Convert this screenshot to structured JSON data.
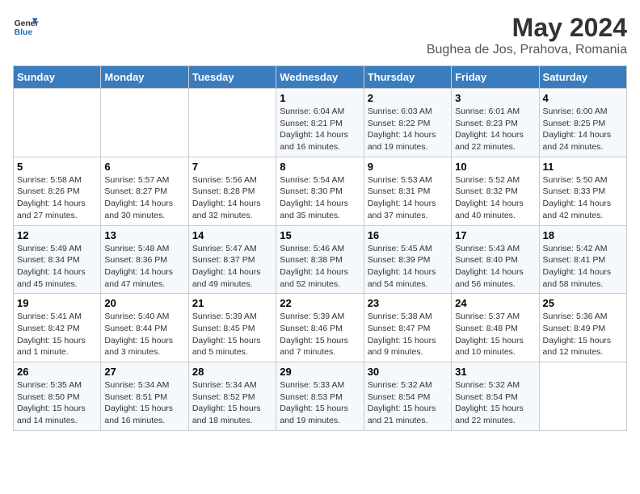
{
  "header": {
    "logo_line1": "General",
    "logo_line2": "Blue",
    "month_title": "May 2024",
    "location": "Bughea de Jos, Prahova, Romania"
  },
  "weekdays": [
    "Sunday",
    "Monday",
    "Tuesday",
    "Wednesday",
    "Thursday",
    "Friday",
    "Saturday"
  ],
  "weeks": [
    [
      null,
      null,
      null,
      {
        "day": 1,
        "sunrise": "6:04 AM",
        "sunset": "8:21 PM",
        "daylight": "14 hours and 16 minutes."
      },
      {
        "day": 2,
        "sunrise": "6:03 AM",
        "sunset": "8:22 PM",
        "daylight": "14 hours and 19 minutes."
      },
      {
        "day": 3,
        "sunrise": "6:01 AM",
        "sunset": "8:23 PM",
        "daylight": "14 hours and 22 minutes."
      },
      {
        "day": 4,
        "sunrise": "6:00 AM",
        "sunset": "8:25 PM",
        "daylight": "14 hours and 24 minutes."
      }
    ],
    [
      {
        "day": 5,
        "sunrise": "5:58 AM",
        "sunset": "8:26 PM",
        "daylight": "14 hours and 27 minutes."
      },
      {
        "day": 6,
        "sunrise": "5:57 AM",
        "sunset": "8:27 PM",
        "daylight": "14 hours and 30 minutes."
      },
      {
        "day": 7,
        "sunrise": "5:56 AM",
        "sunset": "8:28 PM",
        "daylight": "14 hours and 32 minutes."
      },
      {
        "day": 8,
        "sunrise": "5:54 AM",
        "sunset": "8:30 PM",
        "daylight": "14 hours and 35 minutes."
      },
      {
        "day": 9,
        "sunrise": "5:53 AM",
        "sunset": "8:31 PM",
        "daylight": "14 hours and 37 minutes."
      },
      {
        "day": 10,
        "sunrise": "5:52 AM",
        "sunset": "8:32 PM",
        "daylight": "14 hours and 40 minutes."
      },
      {
        "day": 11,
        "sunrise": "5:50 AM",
        "sunset": "8:33 PM",
        "daylight": "14 hours and 42 minutes."
      }
    ],
    [
      {
        "day": 12,
        "sunrise": "5:49 AM",
        "sunset": "8:34 PM",
        "daylight": "14 hours and 45 minutes."
      },
      {
        "day": 13,
        "sunrise": "5:48 AM",
        "sunset": "8:36 PM",
        "daylight": "14 hours and 47 minutes."
      },
      {
        "day": 14,
        "sunrise": "5:47 AM",
        "sunset": "8:37 PM",
        "daylight": "14 hours and 49 minutes."
      },
      {
        "day": 15,
        "sunrise": "5:46 AM",
        "sunset": "8:38 PM",
        "daylight": "14 hours and 52 minutes."
      },
      {
        "day": 16,
        "sunrise": "5:45 AM",
        "sunset": "8:39 PM",
        "daylight": "14 hours and 54 minutes."
      },
      {
        "day": 17,
        "sunrise": "5:43 AM",
        "sunset": "8:40 PM",
        "daylight": "14 hours and 56 minutes."
      },
      {
        "day": 18,
        "sunrise": "5:42 AM",
        "sunset": "8:41 PM",
        "daylight": "14 hours and 58 minutes."
      }
    ],
    [
      {
        "day": 19,
        "sunrise": "5:41 AM",
        "sunset": "8:42 PM",
        "daylight": "15 hours and 1 minute."
      },
      {
        "day": 20,
        "sunrise": "5:40 AM",
        "sunset": "8:44 PM",
        "daylight": "15 hours and 3 minutes."
      },
      {
        "day": 21,
        "sunrise": "5:39 AM",
        "sunset": "8:45 PM",
        "daylight": "15 hours and 5 minutes."
      },
      {
        "day": 22,
        "sunrise": "5:39 AM",
        "sunset": "8:46 PM",
        "daylight": "15 hours and 7 minutes."
      },
      {
        "day": 23,
        "sunrise": "5:38 AM",
        "sunset": "8:47 PM",
        "daylight": "15 hours and 9 minutes."
      },
      {
        "day": 24,
        "sunrise": "5:37 AM",
        "sunset": "8:48 PM",
        "daylight": "15 hours and 10 minutes."
      },
      {
        "day": 25,
        "sunrise": "5:36 AM",
        "sunset": "8:49 PM",
        "daylight": "15 hours and 12 minutes."
      }
    ],
    [
      {
        "day": 26,
        "sunrise": "5:35 AM",
        "sunset": "8:50 PM",
        "daylight": "15 hours and 14 minutes."
      },
      {
        "day": 27,
        "sunrise": "5:34 AM",
        "sunset": "8:51 PM",
        "daylight": "15 hours and 16 minutes."
      },
      {
        "day": 28,
        "sunrise": "5:34 AM",
        "sunset": "8:52 PM",
        "daylight": "15 hours and 18 minutes."
      },
      {
        "day": 29,
        "sunrise": "5:33 AM",
        "sunset": "8:53 PM",
        "daylight": "15 hours and 19 minutes."
      },
      {
        "day": 30,
        "sunrise": "5:32 AM",
        "sunset": "8:54 PM",
        "daylight": "15 hours and 21 minutes."
      },
      {
        "day": 31,
        "sunrise": "5:32 AM",
        "sunset": "8:54 PM",
        "daylight": "15 hours and 22 minutes."
      },
      null
    ]
  ]
}
